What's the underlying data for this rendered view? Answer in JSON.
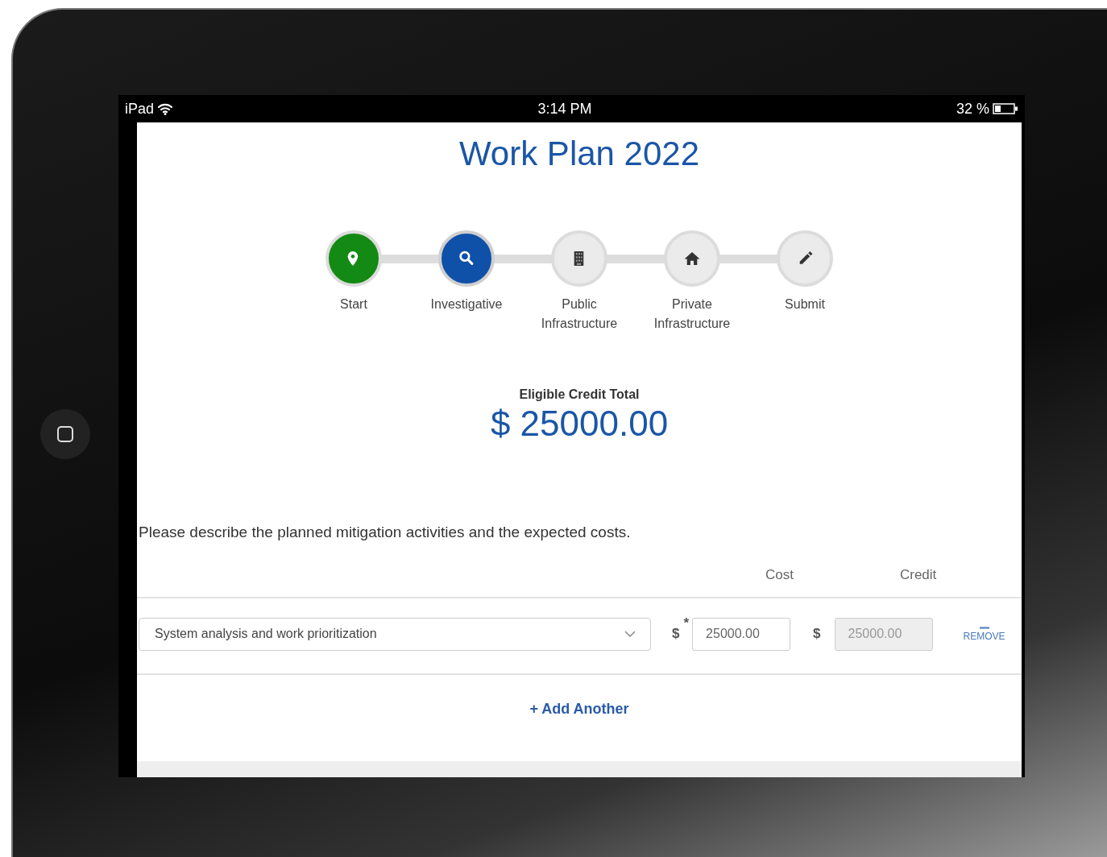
{
  "status_bar": {
    "device": "iPad",
    "time": "3:14 PM",
    "battery_text": "32 %"
  },
  "title": "Work Plan 2022",
  "steps": [
    {
      "label": "Start",
      "completed": true,
      "selected": false
    },
    {
      "label": "Investigative",
      "completed": false,
      "selected": true
    },
    {
      "label": "Public Infrastructure",
      "completed": false,
      "selected": false
    },
    {
      "label": "Private Infrastructure",
      "completed": false,
      "selected": false
    },
    {
      "label": "Submit",
      "completed": false,
      "selected": false
    }
  ],
  "credit_total": {
    "label": "Eligible Credit Total",
    "amount": "$ 25000.00"
  },
  "instructions": "Please describe the planned mitigation activities and the expected costs.",
  "columns": [
    "Cost",
    "Credit"
  ],
  "rows": [
    {
      "activity": "System analysis and work prioritization",
      "cost_currency": "$",
      "required_mark": "*",
      "cost": "25000.00",
      "credit_currency": "$",
      "credit": "25000.00",
      "credit_disabled": true,
      "remove": "REMOVE"
    }
  ],
  "add_button": "+ Add Another"
}
